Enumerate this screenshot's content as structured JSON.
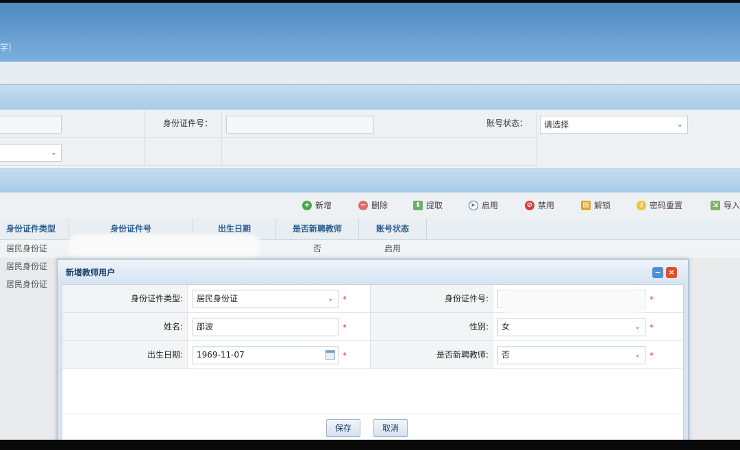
{
  "header": {
    "title_fragment": "学）"
  },
  "search": {
    "id_number_label": "身份证件号：",
    "account_status_label": "账号状态：",
    "account_status_value": "请选择"
  },
  "toolbar": {
    "add": "新增",
    "delete": "删除",
    "extract": "提取",
    "enable": "启用",
    "disable": "禁用",
    "unlock": "解锁",
    "reset_password": "密码重置",
    "import": "导入"
  },
  "table": {
    "columns": [
      "身份证件类型",
      "身份证件号",
      "出生日期",
      "是否新聘教师",
      "账号状态"
    ],
    "rows": [
      {
        "id_type": "居民身份证",
        "is_new_teacher": "否",
        "status": "启用"
      },
      {
        "id_type": "居民身份证"
      },
      {
        "id_type": "居民身份证"
      }
    ]
  },
  "dialog": {
    "title": "新增教师用户",
    "fields": {
      "id_type_label": "身份证件类型:",
      "id_type_value": "居民身份证",
      "id_number_label": "身份证件号:",
      "name_label": "姓名:",
      "name_value": "邵波",
      "gender_label": "性别:",
      "gender_value": "女",
      "birth_label": "出生日期:",
      "birth_value": "1969-11-07",
      "new_teacher_label": "是否新聘教师:",
      "new_teacher_value": "否"
    },
    "required_mark": "*",
    "save": "保存",
    "cancel": "取消"
  },
  "icons": {
    "chevron": "chevron-down-icon",
    "minimize": "minimize-icon",
    "close": "close-icon"
  },
  "colors": {
    "banner": "#5a93c9",
    "accent_blue": "#2b5d8f",
    "required_red": "#e03a3a",
    "close_red": "#e0502e"
  }
}
